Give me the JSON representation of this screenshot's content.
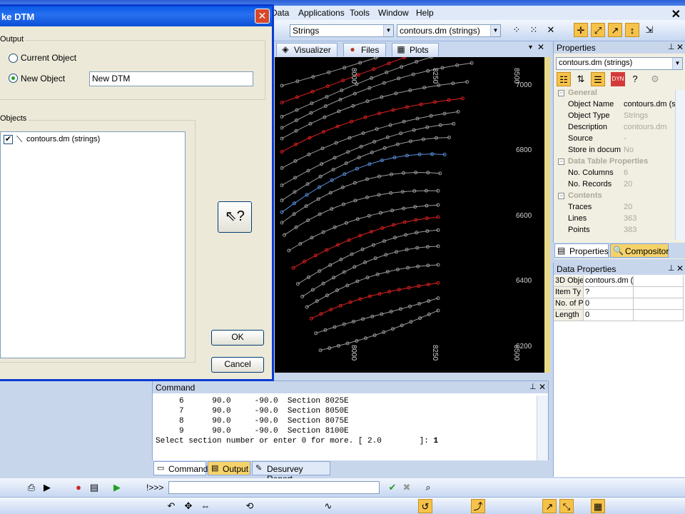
{
  "menu": {
    "items": [
      "Data",
      "Applications",
      "Tools",
      "Window",
      "Help"
    ]
  },
  "toolbar": {
    "strings_combo": "Strings",
    "object_combo": "contours.dm (strings)"
  },
  "view_tabs": [
    {
      "label": "Visualizer",
      "icon": "visualizer-icon"
    },
    {
      "label": "Files",
      "icon": "files-icon"
    },
    {
      "label": "Plots",
      "icon": "plots-icon"
    }
  ],
  "viewport": {
    "grid_labels_top": [
      "8000",
      "8250",
      "8500"
    ],
    "grid_labels_bottom": [
      "8000",
      "8250",
      "8500"
    ],
    "grid_labels_right": [
      "7000",
      "6800",
      "6600",
      "6400",
      "6200"
    ],
    "colors": {
      "background": "#000000",
      "grey_contour": "#9a9a9a",
      "red_contour": "#e02020",
      "blue_contour": "#5a8fd8"
    }
  },
  "properties": {
    "title": "Properties",
    "object_selector": "contours.dm (strings)",
    "rows": [
      {
        "type": "cat",
        "label": "General"
      },
      {
        "label": "Object Name",
        "value": "contours.dm (st",
        "dark": true
      },
      {
        "label": "Object Type",
        "value": "Strings"
      },
      {
        "label": "Description",
        "value": "contours.dm"
      },
      {
        "label": "Source",
        "value": "-"
      },
      {
        "label": "Store in docum",
        "value": "No"
      },
      {
        "type": "cat",
        "label": "Data Table Properties"
      },
      {
        "label": "No. Columns",
        "value": "6"
      },
      {
        "label": "No. Records",
        "value": "20"
      },
      {
        "type": "cat",
        "label": "Contents"
      },
      {
        "label": "Traces",
        "value": "20"
      },
      {
        "label": "Lines",
        "value": "363"
      },
      {
        "label": "Points",
        "value": "383"
      }
    ],
    "tabs": [
      "Properties",
      "Compositor"
    ]
  },
  "data_properties": {
    "title": "Data Properties",
    "rows": [
      [
        "3D Obje",
        "contours.dm (",
        ""
      ],
      [
        "Item Ty",
        "?",
        ""
      ],
      [
        "No. of P",
        "0",
        ""
      ],
      [
        "Length",
        "0",
        ""
      ]
    ]
  },
  "command": {
    "title": "Command",
    "lines": [
      "     6      90.0     -90.0  Section 8025E",
      "     7      90.0     -90.0  Section 8050E",
      "     8      90.0     -90.0  Section 8075E",
      "     9      90.0     -90.0  Section 8100E"
    ],
    "prompt": "Select section number or enter 0 for more. [ 2.0        ]: ",
    "prompt_value": "1",
    "tabs": [
      "Command",
      "Output",
      "Desurvey Report"
    ],
    "input_prefix": "!>>>"
  },
  "dialog": {
    "title": "ke DTM",
    "output_group": "Output",
    "current_object": "Current Object",
    "new_object": "New Object",
    "new_object_value": "New DTM",
    "objects_group": "Objects",
    "objects": [
      "contours.dm (strings)"
    ],
    "ok": "OK",
    "cancel": "Cancel"
  }
}
